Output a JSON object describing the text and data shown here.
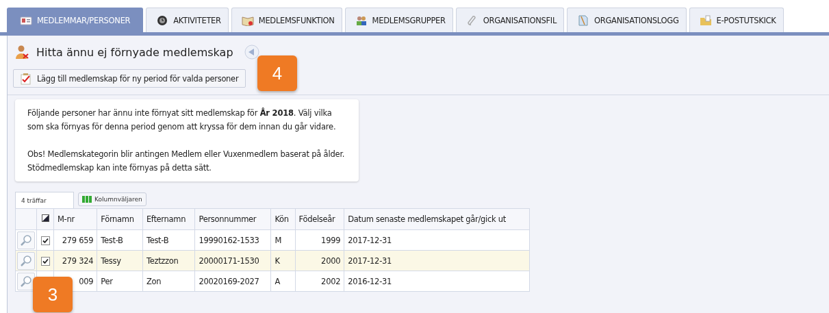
{
  "tabs": [
    {
      "label": "MEDLEMMAR/PERSONER",
      "selected": true
    },
    {
      "label": "AKTIVITETER",
      "selected": false
    },
    {
      "label": "MEDLEMSFUNKTION",
      "selected": false
    },
    {
      "label": "MEDLEMSGRUPPER",
      "selected": false
    },
    {
      "label": "ORGANISATIONSFIL",
      "selected": false
    },
    {
      "label": "ORGANISATIONSLOGG",
      "selected": false
    },
    {
      "label": "E-POSTUTSKICK",
      "selected": false
    }
  ],
  "page_title": "Hitta ännu ej förnyade medlemskap",
  "action_button": "Lägg till medlemskap för ny period för valda personer",
  "info": [
    "Följande personer har ännu inte förnyat sitt medlemskap för **År 2018**. Välj vilka som ska förnyas för denna period genom att kryssa för dem innan du går vidare.",
    "Obs! Medlemskategorin blir antingen Medlem eller Vuxenmedlem baserat på ålder. Stödmedlemskap kan inte förnyas på detta sätt."
  ],
  "hits": "4 träffar",
  "column_chooser": "Kolumnväljaren",
  "table": {
    "select_all_partial": true,
    "columns": [
      "M-nr",
      "Förnamn",
      "Efternamn",
      "Personnummer",
      "Kön",
      "Födelseår",
      "Datum senaste medlemskapet går/gick ut"
    ],
    "rows": [
      {
        "cells": [
          "279 659",
          "Test-B",
          "Test-B",
          "19990162-1533",
          "M",
          "1999",
          "2017-12-31"
        ],
        "checked": true,
        "selected": false
      },
      {
        "cells": [
          "279 324",
          "Tessy",
          "Teztzzon",
          "20000171-1530",
          "K",
          "2000",
          "2017-12-31"
        ],
        "checked": true,
        "selected": true
      },
      {
        "cells": [
          "009",
          "Per",
          "Zon",
          "20020169-2027",
          "A",
          "2002",
          "2016-12-31"
        ],
        "selected": false
      }
    ]
  },
  "callouts": [
    {
      "label": "4"
    },
    {
      "label": "3"
    }
  ]
}
